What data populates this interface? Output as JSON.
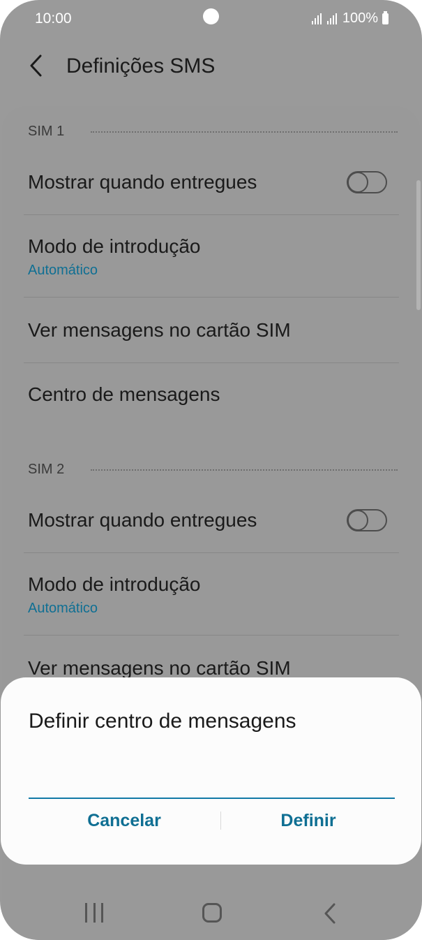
{
  "status": {
    "time": "10:00",
    "battery": "100%"
  },
  "appbar": {
    "title": "Definições SMS"
  },
  "sim1": {
    "header": "SIM 1",
    "delivery_label": "Mostrar quando entregues",
    "delivery_on": false,
    "input_mode_label": "Modo de introdução",
    "input_mode_value": "Automático",
    "view_sim_label": "Ver mensagens no cartão SIM",
    "center_label": "Centro de mensagens"
  },
  "sim2": {
    "header": "SIM 2",
    "delivery_label": "Mostrar quando entregues",
    "delivery_on": false,
    "input_mode_label": "Modo de introdução",
    "input_mode_value": "Automático",
    "view_sim_label": "Ver mensagens no cartão SIM"
  },
  "dialog": {
    "title": "Definir centro de mensagens",
    "input_value": "",
    "cancel_label": "Cancelar",
    "confirm_label": "Definir"
  },
  "colors": {
    "accent": "#0f6f93",
    "scrim": "#9a9a9a",
    "dialog_bg": "#fcfcfc"
  },
  "icons": {
    "back": "chevron-left-icon",
    "nav_recents": "recents-icon",
    "nav_home": "home-icon",
    "nav_back": "back-icon"
  }
}
